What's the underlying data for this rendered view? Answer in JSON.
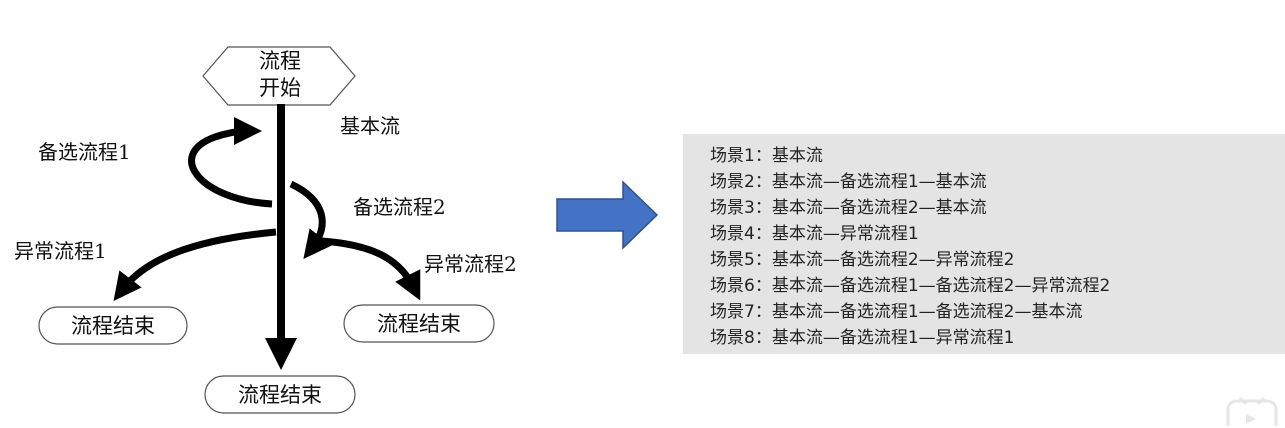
{
  "diagram": {
    "start_node": [
      "流程",
      "开始"
    ],
    "end_main": "流程结束",
    "end_left": "流程结束",
    "end_right": "流程结束",
    "label_basic": "基本流",
    "label_alt1": "备选流程1",
    "label_alt2": "备选流程2",
    "label_exc1": "异常流程1",
    "label_exc2": "异常流程2"
  },
  "colors": {
    "arrow_fill": "#4472c4",
    "arrow_stroke": "#2f528f",
    "panel_bg": "#e4e4e4"
  },
  "scenarios": [
    "场景1：基本流",
    "场景2：基本流—备选流程1—基本流",
    "场景3：基本流—备选流程2—基本流",
    "场景4：基本流—异常流程1",
    "场景5：基本流—备选流程2—异常流程2",
    "场景6：基本流—备选流程1—备选流程2—异常流程2",
    "场景7：基本流—备选流程1—备选流程2—基本流",
    "场景8：基本流—备选流程1—异常流程1"
  ]
}
